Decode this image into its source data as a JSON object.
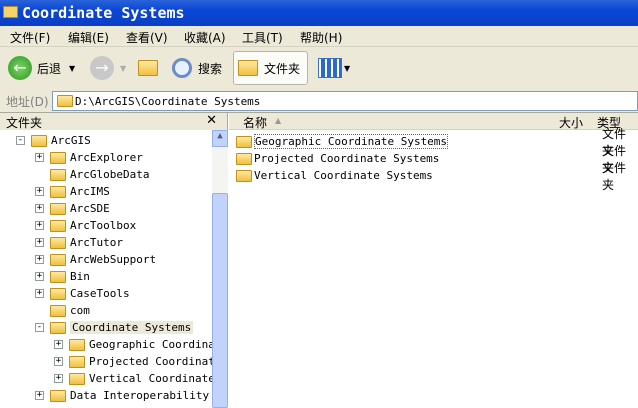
{
  "window": {
    "title": "Coordinate Systems"
  },
  "menu": [
    "文件(F)",
    "编辑(E)",
    "查看(V)",
    "收藏(A)",
    "工具(T)",
    "帮助(H)"
  ],
  "toolbar": {
    "back": "后退",
    "search": "搜索",
    "folders": "文件夹"
  },
  "address": {
    "label": "地址(D)",
    "value": "D:\\ArcGIS\\Coordinate Systems"
  },
  "folders_pane": {
    "title": "文件夹",
    "close": "✕",
    "tree": [
      {
        "label": "ArcGIS",
        "level": 0,
        "exp": "-"
      },
      {
        "label": "ArcExplorer",
        "level": 1,
        "exp": "+"
      },
      {
        "label": "ArcGlobeData",
        "level": 1,
        "exp": ""
      },
      {
        "label": "ArcIMS",
        "level": 1,
        "exp": "+"
      },
      {
        "label": "ArcSDE",
        "level": 1,
        "exp": "+"
      },
      {
        "label": "ArcToolbox",
        "level": 1,
        "exp": "+"
      },
      {
        "label": "ArcTutor",
        "level": 1,
        "exp": "+"
      },
      {
        "label": "ArcWebSupport",
        "level": 1,
        "exp": "+"
      },
      {
        "label": "Bin",
        "level": 1,
        "exp": "+"
      },
      {
        "label": "CaseTools",
        "level": 1,
        "exp": "+"
      },
      {
        "label": "com",
        "level": 1,
        "exp": ""
      },
      {
        "label": "Coordinate Systems",
        "level": 1,
        "exp": "-",
        "selected": true
      },
      {
        "label": "Geographic Coordinat",
        "level": 2,
        "exp": "+"
      },
      {
        "label": "Projected Coordinate",
        "level": 2,
        "exp": "+"
      },
      {
        "label": "Vertical Coordinate S",
        "level": 2,
        "exp": "+"
      },
      {
        "label": "Data Interoperability Ex",
        "level": 1,
        "exp": "+"
      }
    ]
  },
  "list": {
    "columns": {
      "name": "名称",
      "size": "大小",
      "type": "类型"
    },
    "rows": [
      {
        "name": "Geographic Coordinate Systems",
        "type": "文件夹"
      },
      {
        "name": "Projected Coordinate Systems",
        "type": "文件夹"
      },
      {
        "name": "Vertical Coordinate Systems",
        "type": "文件夹"
      }
    ]
  }
}
